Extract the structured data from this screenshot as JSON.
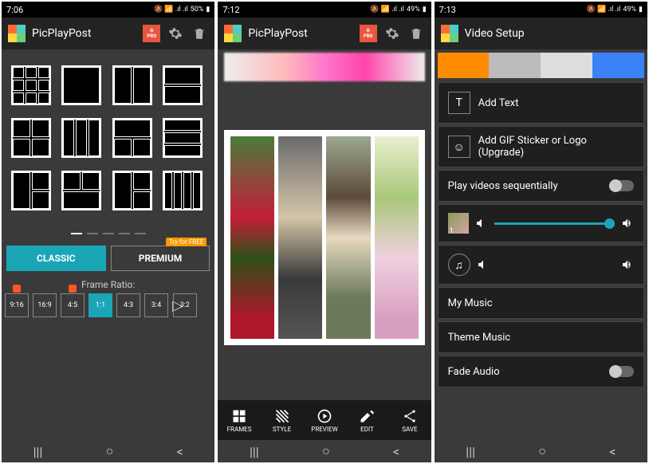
{
  "screens": [
    {
      "status": {
        "time": "7:06",
        "battery": "50%",
        "icons": "🔇📶📶📶"
      },
      "title": "PicPlayPost",
      "dots_active": 0,
      "tabs": {
        "classic": "CLASSIC",
        "premium": "PREMIUM",
        "try_free": "Try for FREE"
      },
      "ratio_label": "Frame Ratio:",
      "ratios": [
        "9:16",
        "16:9",
        "4:5",
        "1:1",
        "4:3",
        "3:4",
        "3:2"
      ],
      "ratio_active": 3
    },
    {
      "status": {
        "time": "7:12",
        "battery": "49%",
        "icons": "🔇📶📶📶"
      },
      "title": "PicPlayPost",
      "toolbar": [
        {
          "id": "frames",
          "label": "FRAMES"
        },
        {
          "id": "style",
          "label": "STYLE"
        },
        {
          "id": "preview",
          "label": "PREVIEW"
        },
        {
          "id": "edit",
          "label": "EDIT"
        },
        {
          "id": "save",
          "label": "SAVE"
        }
      ]
    },
    {
      "status": {
        "time": "7:13",
        "battery": "49%",
        "icons": "🔇📶📶📶"
      },
      "title": "Video Setup",
      "settings": {
        "add_text": "Add Text",
        "add_gif": "Add GIF Sticker or Logo (Upgrade)",
        "play_seq": "Play videos sequentially",
        "thumb_label": "1",
        "my_music": "My Music",
        "theme_music": "Theme Music",
        "fade_audio": "Fade Audio"
      }
    }
  ]
}
